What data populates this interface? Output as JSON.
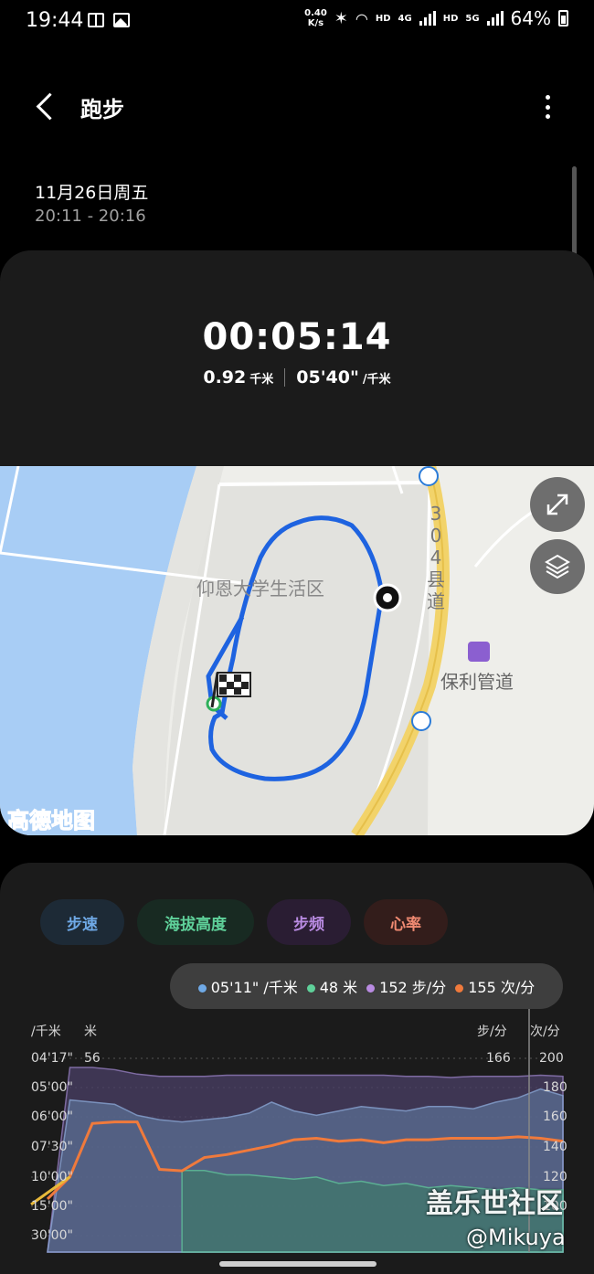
{
  "status_bar": {
    "time": "19:44",
    "net_speed_value": "0.40",
    "net_speed_unit": "K/s",
    "hd1": "HD",
    "net1": "4G",
    "hd2": "HD",
    "net2": "5G",
    "battery": "64%"
  },
  "header": {
    "title": "跑步"
  },
  "session": {
    "date": "11月26日周五",
    "time_range": "20:11 - 20:16"
  },
  "summary": {
    "duration": "00:05:14",
    "distance_value": "0.92",
    "distance_unit": "千米",
    "pace_value": "05'40\"",
    "pace_unit": "/千米"
  },
  "map": {
    "campus_label": "仰恩大学生活区",
    "road_label_chars": [
      "3",
      "0",
      "4",
      "县",
      "道"
    ],
    "poi_label": "保利管道",
    "provider": "高德地图"
  },
  "tabs": [
    {
      "label": "步速"
    },
    {
      "label": "海拔高度"
    },
    {
      "label": "步频"
    },
    {
      "label": "心率"
    }
  ],
  "tooltip": {
    "pace": "05'11\" /千米",
    "altitude": "48 米",
    "cadence": "152 步/分",
    "heart_rate": "155 次/分"
  },
  "colors": {
    "pace": "#6fa9e6",
    "altitude": "#5fd19a",
    "cadence": "#b98be2",
    "heart_rate": "#f07a3c",
    "start_line": "#e8b93a"
  },
  "axes": {
    "left_pace_unit": "/千米",
    "left_alt_unit": "米",
    "right_cadence_unit": "步/分",
    "right_hr_unit": "次/分",
    "pace_ticks": [
      "04'17\"",
      "05'00\"",
      "06'00\"",
      "07'30\"",
      "10'00\"",
      "15'00\"",
      "30'00\""
    ],
    "altitude_top_tick": "56",
    "cadence_top_tick": "166",
    "hr_ticks": [
      "200",
      "180",
      "160",
      "140",
      "120",
      "100"
    ]
  },
  "chart_data": {
    "type": "area",
    "x_label": "",
    "series": [
      {
        "name": "步频",
        "values": [
          0,
          166,
          166,
          164,
          160,
          158,
          158,
          158,
          159,
          159,
          159,
          159,
          159,
          159,
          159,
          159,
          158,
          158,
          157,
          158,
          158,
          158,
          159,
          158
        ]
      },
      {
        "name": "步速",
        "values": [
          0,
          6.1,
          6.2,
          6.3,
          6.8,
          7.0,
          7.1,
          7.0,
          6.9,
          6.7,
          6.2,
          6.6,
          6.8,
          6.6,
          6.4,
          6.5,
          6.6,
          6.4,
          6.4,
          6.5,
          6.2,
          6.0,
          5.6,
          5.9
        ]
      },
      {
        "name": "心率",
        "values": [
          105,
          120,
          156,
          157,
          157,
          125,
          124,
          133,
          135,
          138,
          141,
          145,
          146,
          144,
          145,
          143,
          145,
          145,
          146,
          146,
          146,
          147,
          146,
          144
        ]
      },
      {
        "name": "海拔高度",
        "values": [
          null,
          null,
          null,
          null,
          null,
          null,
          38,
          38,
          36,
          36,
          35,
          34,
          35,
          32,
          33,
          31,
          32,
          30,
          31,
          30,
          29,
          30,
          29,
          29
        ]
      }
    ],
    "yrange_hr": [
      100,
      200
    ],
    "yrange_cadence": [
      0,
      166
    ]
  },
  "watermark": {
    "line1": "盖乐世社区",
    "line2": "@Mikuya"
  }
}
